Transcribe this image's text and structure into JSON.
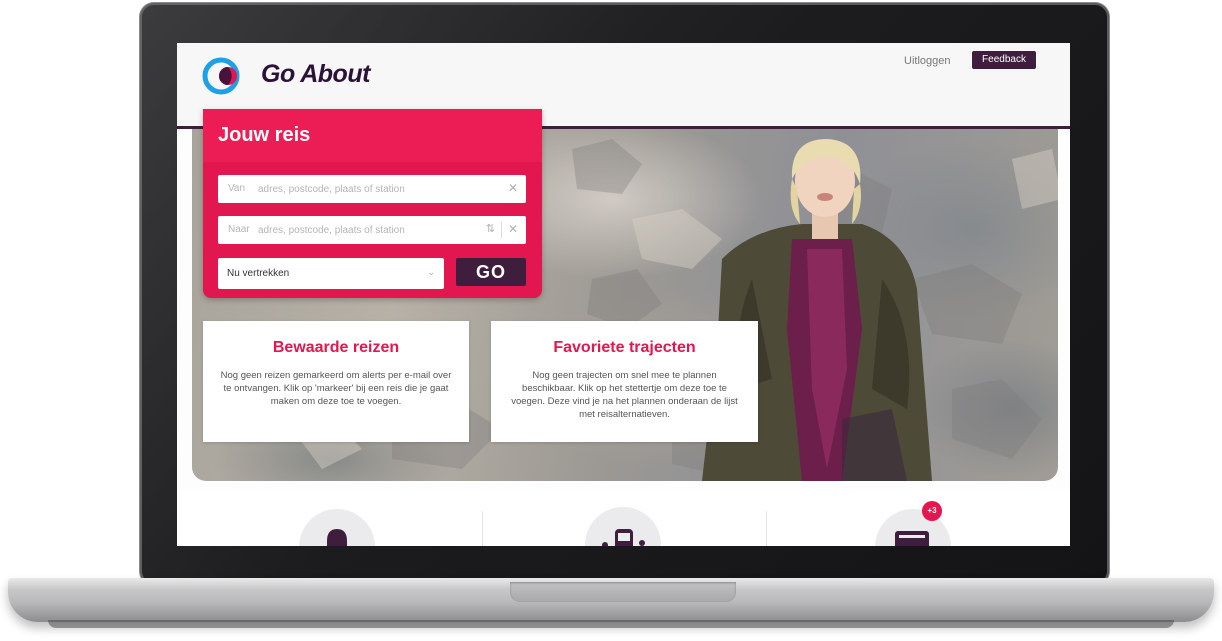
{
  "header": {
    "logo_text": "Go About",
    "logout_label": "Uitloggen",
    "feedback_label": "Feedback"
  },
  "journey": {
    "title": "Jouw reis",
    "from": {
      "prefix": "Van",
      "placeholder": "adres, postcode, plaats of station"
    },
    "to": {
      "prefix": "Naar",
      "placeholder": "adres, postcode, plaats of station"
    },
    "time_option": "Nu vertrekken",
    "go_label": "GO"
  },
  "cards": [
    {
      "title": "Bewaarde reizen",
      "body": "Nog geen reizen gemarkeerd om alerts per e-mail over te ontvangen. Klik op 'markeer' bij een reis die je gaat maken om deze toe te voegen."
    },
    {
      "title": "Favoriete trajecten",
      "body": "Nog geen trajecten om snel mee te plannen beschikbaar. Klik op het stettertje om deze toe te voegen. Deze vind je na het plannen onderaan de lijst met reisalternatieven."
    }
  ],
  "features": {
    "badge": "+3"
  },
  "colors": {
    "brand_pink": "#e2174f",
    "brand_purple": "#3e1e3c",
    "logo_blue": "#1ea0e6"
  }
}
